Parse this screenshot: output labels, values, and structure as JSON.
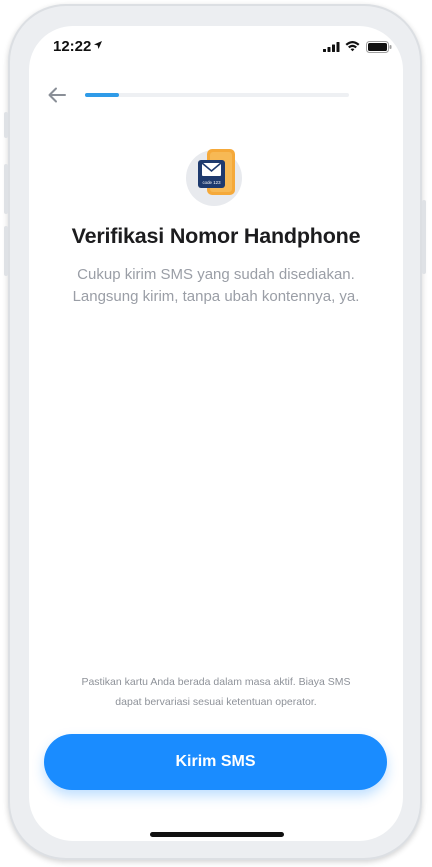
{
  "status_bar": {
    "time": "12:22"
  },
  "header": {
    "progress_fraction": 0.13
  },
  "content": {
    "title": "Verifikasi Nomor Handphone",
    "subtitle_lines": [
      "Cukup kirim SMS yang sudah disediakan.",
      "Langsung kirim, tanpa ubah kontennya, ya."
    ],
    "illustration": {
      "icon": "phone-envelope-icon",
      "phone_label": "code 123"
    }
  },
  "footer": {
    "note_lines": [
      "Pastikan kartu Anda berada dalam masa aktif. Biaya SMS",
      "dapat bervariasi sesuai ketentuan operator."
    ],
    "button_label": "Kirim SMS"
  },
  "colors": {
    "accent": "#1a8cff",
    "progress": "#2f9be8",
    "illustration_phone": "#f5a93a",
    "illustration_envelope": "#1e3a6e"
  }
}
